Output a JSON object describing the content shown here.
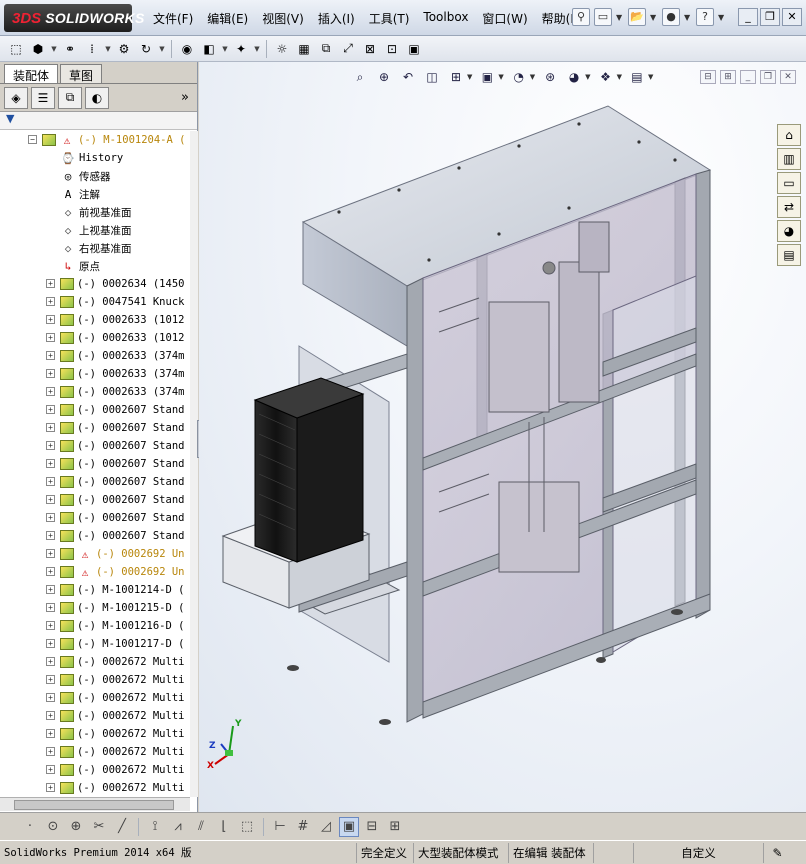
{
  "app": {
    "logo_prefix": "3DS",
    "logo_text": "SOLIDWORKS"
  },
  "menu": [
    "文件(F)",
    "编辑(E)",
    "视图(V)",
    "插入(I)",
    "工具(T)",
    "Toolbox",
    "窗口(W)",
    "帮助(H)"
  ],
  "feature_manager": {
    "tabs": [
      "装配体",
      "草图"
    ],
    "more_glyph": "»",
    "filter_glyph": "▼",
    "root": {
      "label": "(-) M-1001204-A (",
      "warning": true
    },
    "fixed_items": [
      {
        "label": "History",
        "icon": "history-icon"
      },
      {
        "label": "传感器",
        "icon": "sensor-icon"
      },
      {
        "label": "注解",
        "icon": "annotation-icon"
      },
      {
        "label": "前视基准面",
        "icon": "plane-icon"
      },
      {
        "label": "上视基准面",
        "icon": "plane-icon"
      },
      {
        "label": "右视基准面",
        "icon": "plane-icon"
      },
      {
        "label": "原点",
        "icon": "origin-icon"
      }
    ],
    "components": [
      {
        "label": "(-) 0002634 (1450",
        "warn": false
      },
      {
        "label": "(-) 0047541 Knuck",
        "warn": false
      },
      {
        "label": "(-) 0002633 (1012",
        "warn": false
      },
      {
        "label": "(-) 0002633 (1012",
        "warn": false
      },
      {
        "label": "(-) 0002633 (374m",
        "warn": false
      },
      {
        "label": "(-) 0002633 (374m",
        "warn": false
      },
      {
        "label": "(-) 0002633 (374m",
        "warn": false
      },
      {
        "label": "(-) 0002607 Stand",
        "warn": false
      },
      {
        "label": "(-) 0002607 Stand",
        "warn": false
      },
      {
        "label": "(-) 0002607 Stand",
        "warn": false
      },
      {
        "label": "(-) 0002607 Stand",
        "warn": false
      },
      {
        "label": "(-) 0002607 Stand",
        "warn": false
      },
      {
        "label": "(-) 0002607 Stand",
        "warn": false
      },
      {
        "label": "(-) 0002607 Stand",
        "warn": false
      },
      {
        "label": "(-) 0002607 Stand",
        "warn": false
      },
      {
        "label": "(-) 0002692 Un",
        "warn": true
      },
      {
        "label": "(-) 0002692 Un",
        "warn": true
      },
      {
        "label": "(-) M-1001214-D (",
        "warn": false
      },
      {
        "label": "(-) M-1001215-D (",
        "warn": false
      },
      {
        "label": "(-) M-1001216-D (",
        "warn": false
      },
      {
        "label": "(-) M-1001217-D (",
        "warn": false
      },
      {
        "label": "(-) 0002672 Multi",
        "warn": false
      },
      {
        "label": "(-) 0002672 Multi",
        "warn": false
      },
      {
        "label": "(-) 0002672 Multi",
        "warn": false
      },
      {
        "label": "(-) 0002672 Multi",
        "warn": false
      },
      {
        "label": "(-) 0002672 Multi",
        "warn": false
      },
      {
        "label": "(-) 0002672 Multi",
        "warn": false
      },
      {
        "label": "(-) 0002672 Multi",
        "warn": false
      },
      {
        "label": "(-) 0002672 Multi",
        "warn": false
      }
    ]
  },
  "triad": {
    "x": "X",
    "y": "Y",
    "z": "Z"
  },
  "status": {
    "app": "SolidWorks Premium 2014 x64 版",
    "mode": "完全定义",
    "large": "大型装配体模式",
    "edit": "在编辑 装配体",
    "custom": "自定义"
  },
  "colors": {
    "frame_panel": "#c9ced8",
    "extrusion": "#9ea3aa",
    "dark_part": "#1e1e1e"
  }
}
